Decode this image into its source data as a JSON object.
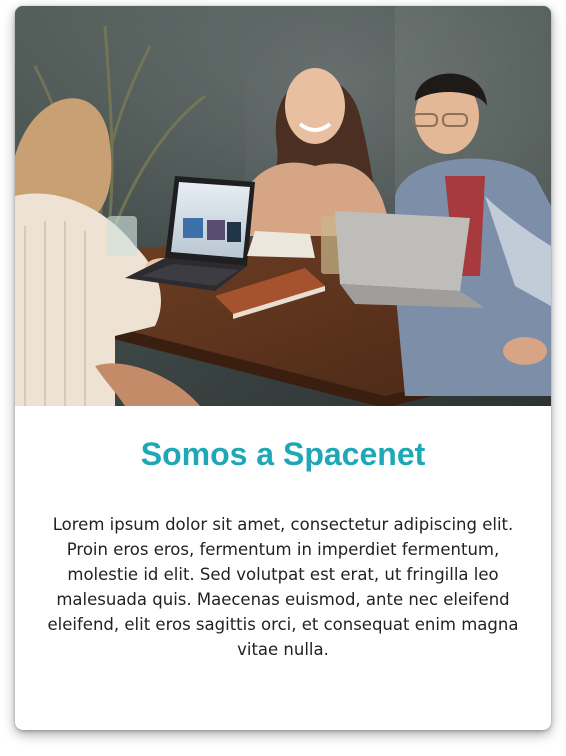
{
  "card": {
    "image": {
      "description_icon": "photo-image"
    },
    "title": "Somos a Spacenet",
    "body": "Lorem ipsum dolor sit amet, consectetur adipiscing elit. Proin eros eros, fermentum in imperdiet fermentum, molestie id elit. Sed volutpat est erat, ut fringilla leo malesuada quis. Maecenas euismod, ante nec eleifend eleifend, elit eros sagittis orci, et consequat enim magna vitae nulla."
  },
  "colors": {
    "title": "#1ea7b7",
    "text": "#222222",
    "background": "#ffffff"
  }
}
